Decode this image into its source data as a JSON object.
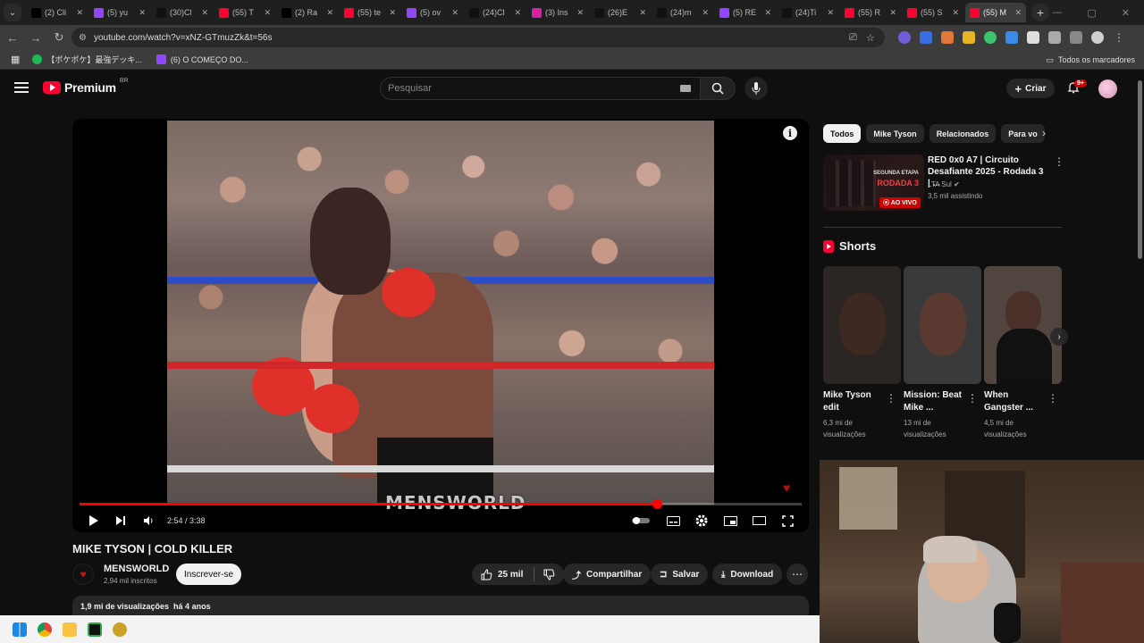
{
  "browser": {
    "tabs": [
      {
        "title": "(2) Cli",
        "icon": "x-icon",
        "color": "#000000",
        "active": false
      },
      {
        "title": "(5) yu",
        "icon": "twitch-icon",
        "color": "#9146ff",
        "active": false
      },
      {
        "title": "(30)Cl",
        "icon": "tiktok-icon",
        "color": "#111111",
        "active": false
      },
      {
        "title": "(55) T",
        "icon": "youtube-icon",
        "color": "#ff0033",
        "active": false
      },
      {
        "title": "(2) Ra",
        "icon": "x-icon",
        "color": "#000000",
        "active": false
      },
      {
        "title": "(55) te",
        "icon": "youtube-icon",
        "color": "#ff0033",
        "active": false
      },
      {
        "title": "(5) ov",
        "icon": "twitch-icon",
        "color": "#9146ff",
        "active": false
      },
      {
        "title": "(24)Cl",
        "icon": "tiktok-icon",
        "color": "#111111",
        "active": false
      },
      {
        "title": "(3) Ins",
        "icon": "instagram-icon",
        "color": "#d6249f",
        "active": false
      },
      {
        "title": "(26)E",
        "icon": "tiktok-icon",
        "color": "#111111",
        "active": false
      },
      {
        "title": "(24)m",
        "icon": "tiktok-icon",
        "color": "#111111",
        "active": false
      },
      {
        "title": "(5) RE",
        "icon": "twitch-icon",
        "color": "#9146ff",
        "active": false
      },
      {
        "title": "(24)Ti",
        "icon": "tiktok-icon",
        "color": "#111111",
        "active": false
      },
      {
        "title": "(55) R",
        "icon": "youtube-icon",
        "color": "#ff0033",
        "active": false
      },
      {
        "title": "(55) S",
        "icon": "youtube-icon",
        "color": "#ff0033",
        "active": false
      },
      {
        "title": "(55) M",
        "icon": "youtube-icon",
        "color": "#ff0033",
        "active": true
      }
    ],
    "url": "youtube.com/watch?v=xNZ-GTmuzZk&t=56s",
    "bookmarks": [
      {
        "label": "【ポケポケ】最強デッキ...",
        "icon": "bookmark-green-icon",
        "color": "#1db954"
      },
      {
        "label": "(6) O COMEÇO DO...",
        "icon": "twitch-icon",
        "color": "#9146ff"
      }
    ],
    "all_bookmarks": "Todos os marcadores"
  },
  "youtube": {
    "logo": "Premium",
    "logo_region": "BR",
    "search_placeholder": "Pesquisar",
    "create_label": "Criar",
    "notifications_badge": "9+",
    "video": {
      "title": "MIKE TYSON | COLD KILLER",
      "watermark": "MENSWORLD",
      "time_current": "2:54",
      "time_total": "3:38",
      "time_display": "2:54 / 3:38",
      "progress": 0.8
    },
    "channel": {
      "name": "MENSWORLD",
      "subs": "2,94 mil inscritos",
      "subscribe_label": "Inscrever-se"
    },
    "actions": {
      "likes": "25 mil",
      "share": "Compartilhar",
      "save": "Salvar",
      "download": "Download"
    },
    "description": "1,9 mi de visualizações  há 4 anos",
    "chips": [
      "Todos",
      "Mike Tyson",
      "Relacionados",
      "Para vo"
    ],
    "recommended": {
      "title": "RED 0x0 A7 | Circuito Desafiante 2025 - Rodada 3 | ...",
      "channel": "LTA Sul",
      "views": "3,5 mil assistindo",
      "thumb_line1": "SEGUNDA ETAPA",
      "thumb_line2": "RODADA 3",
      "live_label": "AO VIVO"
    },
    "shorts_label": "Shorts",
    "shorts": [
      {
        "title": "Mike Tyson edit",
        "meta1": "6,3 mi de",
        "meta2": "visualizações",
        "bg": "#2b2523"
      },
      {
        "title": "Mission: Beat Mike ...",
        "meta1": "13 mi de",
        "meta2": "visualizações",
        "bg": "#3a3a3a"
      },
      {
        "title": "When Gangster ...",
        "meta1": "4,5 mi de",
        "meta2": "visualizações",
        "bg": "#514540"
      }
    ]
  },
  "colors": {
    "accent_red": "#ff0033",
    "bg": "#0f0f0f"
  }
}
